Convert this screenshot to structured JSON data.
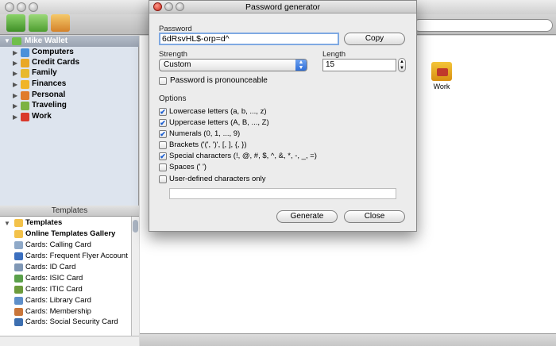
{
  "dialog": {
    "title": "Password generator",
    "password_label": "Password",
    "password_value": "6dRsvHL$-orp=d^",
    "copy_label": "Copy",
    "strength_label": "Strength",
    "strength_value": "Custom",
    "length_label": "Length",
    "length_value": "15",
    "pronounceable_label": "Password is pronounceable",
    "options_label": "Options",
    "options": [
      {
        "label": "Lowercase letters (a, b, ..., z)",
        "checked": true
      },
      {
        "label": "Uppercase letters (A, B, ..., Z)",
        "checked": true
      },
      {
        "label": "Numerals (0, 1, ..., 9)",
        "checked": true
      },
      {
        "label": "Brackets ('(', ')', [, ], {, })",
        "checked": false
      },
      {
        "label": "Special characters (!, @, #, $, ^, &, *, -, _, =)",
        "checked": true
      },
      {
        "label": "Spaces (' ')",
        "checked": false
      },
      {
        "label": "User-defined characters only",
        "checked": false
      }
    ],
    "generate_label": "Generate",
    "close_label": "Close"
  },
  "sidebar": {
    "wallet": "Mike Wallet",
    "items": [
      {
        "label": "Computers",
        "color": "#4a90d9"
      },
      {
        "label": "Credit Cards",
        "color": "#e9a825"
      },
      {
        "label": "Family",
        "color": "#e8b92c"
      },
      {
        "label": "Finances",
        "color": "#f0b429"
      },
      {
        "label": "Personal",
        "color": "#e07b2a"
      },
      {
        "label": "Traveling",
        "color": "#7cb342"
      },
      {
        "label": "Work",
        "color": "#d9382b"
      }
    ]
  },
  "templates": {
    "header": "Templates",
    "root": "Templates",
    "items": [
      "Online Templates Gallery",
      "Cards: Calling Card",
      "Cards: Frequent Flyer Account",
      "Cards: ID Card",
      "Cards: ISIC Card",
      "Cards: ITIC Card",
      "Cards: Library Card",
      "Cards: Membership",
      "Cards: Social Security Card"
    ]
  },
  "content": {
    "work_label": "Work"
  }
}
